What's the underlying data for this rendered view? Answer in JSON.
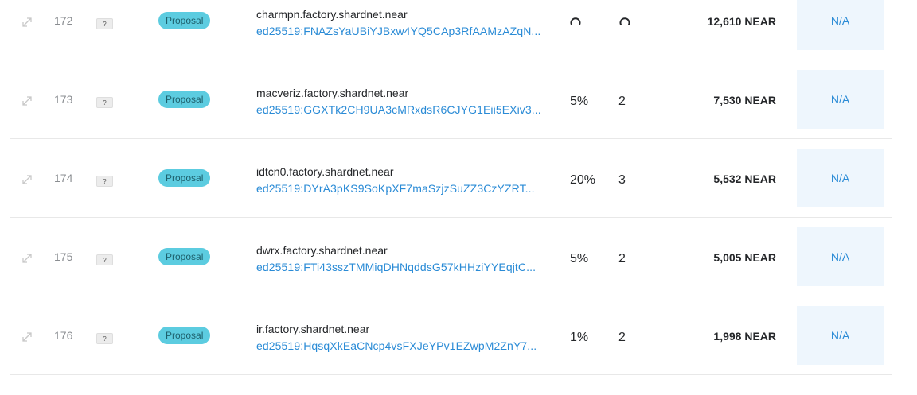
{
  "validators": [
    {
      "index": "172",
      "unknown_badge": "?",
      "status": "Proposal",
      "account": "charmpn.factory.shardnet.near",
      "public_key": "ed25519:FNAZsYaUBiYJBxw4YQ5CAp3RfAAMzAZqN...",
      "fee": "",
      "fee_loading": true,
      "delegators": "",
      "delegators_loading": true,
      "stake": "12,610 NEAR",
      "cumulative_stake": "N/A"
    },
    {
      "index": "173",
      "unknown_badge": "?",
      "status": "Proposal",
      "account": "macveriz.factory.shardnet.near",
      "public_key": "ed25519:GGXTk2CH9UA3cMRxdsR6CJYG1Eii5EXiv3...",
      "fee": "5%",
      "fee_loading": false,
      "delegators": "2",
      "delegators_loading": false,
      "stake": "7,530 NEAR",
      "cumulative_stake": "N/A"
    },
    {
      "index": "174",
      "unknown_badge": "?",
      "status": "Proposal",
      "account": "idtcn0.factory.shardnet.near",
      "public_key": "ed25519:DYrA3pKS9SoKpXF7maSzjzSuZZ3CzYZRT...",
      "fee": "20%",
      "fee_loading": false,
      "delegators": "3",
      "delegators_loading": false,
      "stake": "5,532 NEAR",
      "cumulative_stake": "N/A"
    },
    {
      "index": "175",
      "unknown_badge": "?",
      "status": "Proposal",
      "account": "dwrx.factory.shardnet.near",
      "public_key": "ed25519:FTi43sszTMMiqDHNqddsG57kHHziYYEqjtC...",
      "fee": "5%",
      "fee_loading": false,
      "delegators": "2",
      "delegators_loading": false,
      "stake": "5,005 NEAR",
      "cumulative_stake": "N/A"
    },
    {
      "index": "176",
      "unknown_badge": "?",
      "status": "Proposal",
      "account": "ir.factory.shardnet.near",
      "public_key": "ed25519:HqsqXkEaCNcp4vsFXJeYPv1EZwpM2ZnY7...",
      "fee": "1%",
      "fee_loading": false,
      "delegators": "2",
      "delegators_loading": false,
      "stake": "1,998 NEAR",
      "cumulative_stake": "N/A"
    }
  ],
  "icons": {
    "expand": "expand-arrows-icon",
    "loading": "loading-spinner-icon"
  },
  "colors": {
    "status_badge_bg": "#5ccce0",
    "link": "#2a8bd6",
    "na_box_bg": "#eef6fd"
  }
}
